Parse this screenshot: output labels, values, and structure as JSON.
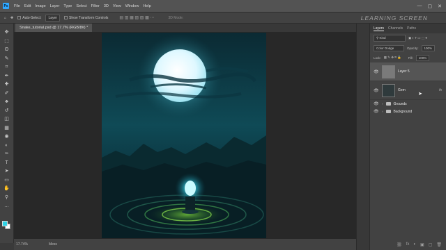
{
  "app": {
    "logo": "Ps"
  },
  "menu": [
    "File",
    "Edit",
    "Image",
    "Layer",
    "Type",
    "Select",
    "Filter",
    "3D",
    "View",
    "Window",
    "Help"
  ],
  "window_controls": [
    "—",
    "▢",
    "✕"
  ],
  "options": {
    "auto_select": "Auto-Select:",
    "auto_select_value": "Layer",
    "show_transform": "Show Transform Controls",
    "mode_3d": "3D Mode:"
  },
  "watermark": "LEARNING SCREEN",
  "document_tab": "Snake_tutorial.psd @ 17.7% (RGB/8#) *",
  "status": {
    "zoom": "17.74%",
    "info": "Mess"
  },
  "tools": [
    "move-icon",
    "marquee-icon",
    "lasso-icon",
    "quick-select-icon",
    "crop-icon",
    "eyedropper-icon",
    "healing-icon",
    "brush-icon",
    "clone-stamp-icon",
    "history-brush-icon",
    "eraser-icon",
    "gradient-icon",
    "blur-icon",
    "dodge-icon",
    "pen-icon",
    "type-icon",
    "path-select-icon",
    "rectangle-icon",
    "hand-icon",
    "zoom-icon",
    "more-tools-icon"
  ],
  "tool_glyphs": [
    "✥",
    "⬚",
    "ʘ",
    "✎",
    "⌗",
    "✒",
    "✚",
    "✐",
    "♣",
    "↺",
    "◫",
    "▦",
    "◉",
    "◐",
    "✑",
    "T",
    "➤",
    "▭",
    "✋",
    "⚲",
    "…"
  ],
  "colors": {
    "foreground": "#2fd3e6",
    "background": "#ffffff"
  },
  "panel": {
    "tabs": [
      "Layers",
      "Channels",
      "Paths"
    ],
    "search_placeholder": "Kind",
    "blend_mode": "Color Dodge",
    "opacity_label": "Opacity:",
    "opacity_value": "100%",
    "lock_label": "Lock:",
    "fill_label": "Fill:",
    "fill_value": "100%",
    "layers": [
      {
        "name": "Layer 5",
        "selected": true
      },
      {
        "name": "Gem",
        "selected": false,
        "fx": "fx"
      }
    ],
    "groups": [
      "Grounds",
      "Background"
    ],
    "bottom_icons": [
      "⛓",
      "fx",
      "◐",
      "▣",
      "▢",
      "🗑"
    ]
  }
}
